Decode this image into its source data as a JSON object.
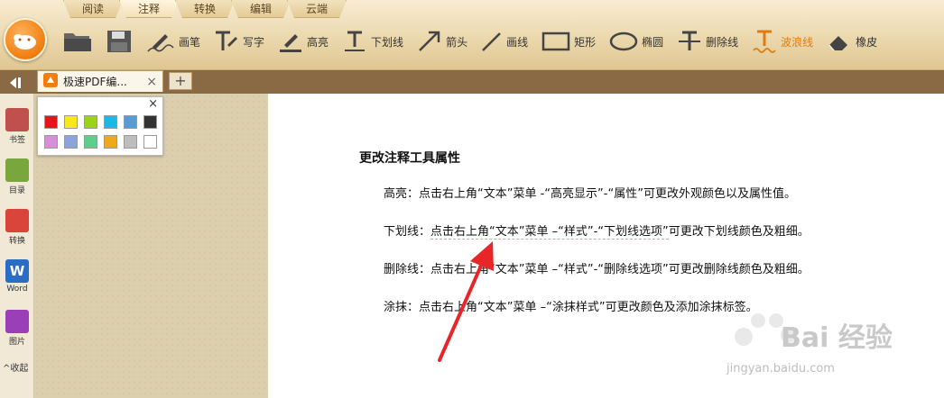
{
  "menu_tabs": [
    "阅读",
    "注释",
    "转换",
    "编辑",
    "云端"
  ],
  "active_menu_tab": "注释",
  "tools": [
    {
      "icon": "folder-open-icon",
      "label": ""
    },
    {
      "icon": "save-icon",
      "label": ""
    },
    {
      "icon": "pen-icon",
      "label": "画笔"
    },
    {
      "icon": "text-tool-icon",
      "label": "写字"
    },
    {
      "icon": "highlight-icon",
      "label": "高亮"
    },
    {
      "icon": "underline-icon",
      "label": "下划线"
    },
    {
      "icon": "arrow-icon",
      "label": "箭头"
    },
    {
      "icon": "line-icon",
      "label": "画线"
    },
    {
      "icon": "rectangle-icon",
      "label": "矩形"
    },
    {
      "icon": "ellipse-icon",
      "label": "椭圆"
    },
    {
      "icon": "strikethrough-icon",
      "label": "删除线"
    },
    {
      "icon": "wavy-line-icon",
      "label": "波浪线"
    },
    {
      "icon": "eraser-icon",
      "label": "橡皮"
    }
  ],
  "tab": {
    "label": "极速PDF编...",
    "close": "×",
    "add": "+"
  },
  "sidebar": {
    "items": [
      {
        "icon": "bookmark-icon",
        "label": "书签",
        "color": "#c0504d"
      },
      {
        "icon": "outline-icon",
        "label": "目录",
        "color": "#7aa73d"
      },
      {
        "icon": "pdf-convert-icon",
        "label": "转换",
        "color": "#d9443b"
      },
      {
        "icon": "word-icon",
        "label": "Word",
        "color": "#2b6cc4"
      },
      {
        "icon": "image-icon",
        "label": "图片",
        "color": "#9b3fb8"
      }
    ],
    "collapse": "收起"
  },
  "palette": {
    "close": "×",
    "colors": [
      "#e8141b",
      "#f7e71c",
      "#9dd21c",
      "#1fb8e0",
      "#5b9bd5",
      "#333333",
      "#d68fd6",
      "#8ea3d9",
      "#5ccf8c",
      "#f0a81d",
      "#bdbdbd",
      "#ffffff"
    ]
  },
  "document": {
    "title": "更改注释工具属性",
    "paragraphs": [
      {
        "prefix": "高亮：",
        "body": "点击右上角“文本”菜单 -“高亮显示”-“属性”可更改外观颜色以及属性值。"
      },
      {
        "prefix": "下划线：",
        "body": "点击右上角“文本”菜单 –“样式”-“下划线选项”",
        "tail": "可更改下划线颜色及粗细。"
      },
      {
        "prefix": "删除线：",
        "body": "点击右上角“文本”菜单 –“样式”-“删除线选项”可更改删除线颜色及粗细。"
      },
      {
        "prefix": "涂抹：",
        "body": "点击右上角“文本”菜单 –“涂抹样式”可更改颜色及添加涂抹标签。"
      }
    ]
  },
  "watermark": {
    "brand": "Bai 经验",
    "url": "jingyan.baidu.com"
  },
  "colors": {
    "accent": "#e07b10",
    "arrow": "#e8262a"
  }
}
